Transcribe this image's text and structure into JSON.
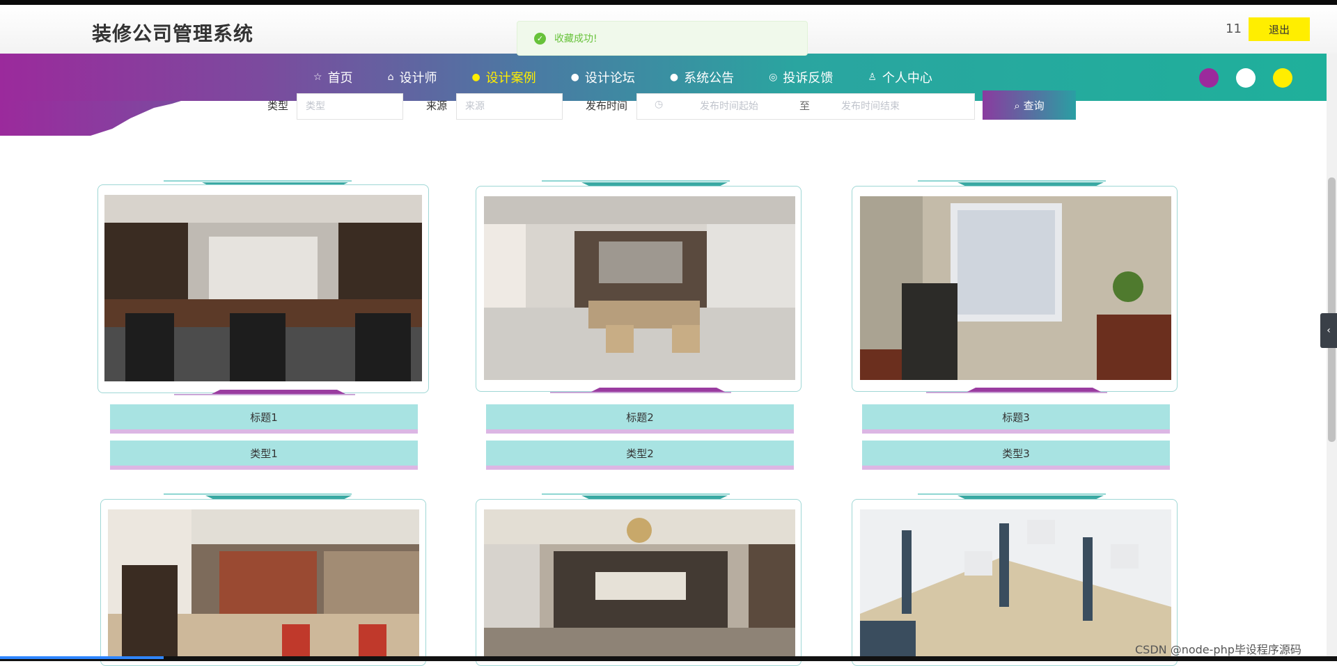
{
  "header": {
    "brand": "装修公司管理系统",
    "user_name": "11",
    "logout_label": "退出"
  },
  "toast": {
    "icon": "check-circle-icon",
    "text": "收藏成功!",
    "color": "#67c23a"
  },
  "nav": {
    "items": [
      {
        "label": "首页",
        "icon": "star-icon",
        "glyph": "☆",
        "active": false
      },
      {
        "label": "设计师",
        "icon": "bag-icon",
        "glyph": "⌂",
        "active": false
      },
      {
        "label": "设计案例",
        "icon": "info-icon",
        "glyph": "●",
        "active": true
      },
      {
        "label": "设计论坛",
        "icon": "help-icon",
        "glyph": "●",
        "active": false
      },
      {
        "label": "系统公告",
        "icon": "info-icon",
        "glyph": "●",
        "active": false
      },
      {
        "label": "投诉反馈",
        "icon": "target-icon",
        "glyph": "◎",
        "active": false
      },
      {
        "label": "个人中心",
        "icon": "user-icon",
        "glyph": "♙",
        "active": false
      }
    ],
    "theme_colors": [
      "#9b2a9c",
      "#ffffff",
      "#ffee00"
    ],
    "active_color": "#ffee00"
  },
  "search": {
    "type_label": "类型",
    "type_placeholder": "类型",
    "source_label": "来源",
    "source_placeholder": "来源",
    "publish_time_label": "发布时间",
    "start_placeholder": "发布时间起始",
    "to_label": "至",
    "end_placeholder": "发布时间结束",
    "search_button": "查询"
  },
  "cards": [
    {
      "title": "标题1",
      "type": "类型1"
    },
    {
      "title": "标题2",
      "type": "类型2"
    },
    {
      "title": "标题3",
      "type": "类型3"
    },
    {
      "title": "",
      "type": ""
    },
    {
      "title": "",
      "type": ""
    },
    {
      "title": "",
      "type": ""
    }
  ],
  "side_tab": "‹",
  "watermark": "CSDN @node-php毕设程序源码"
}
